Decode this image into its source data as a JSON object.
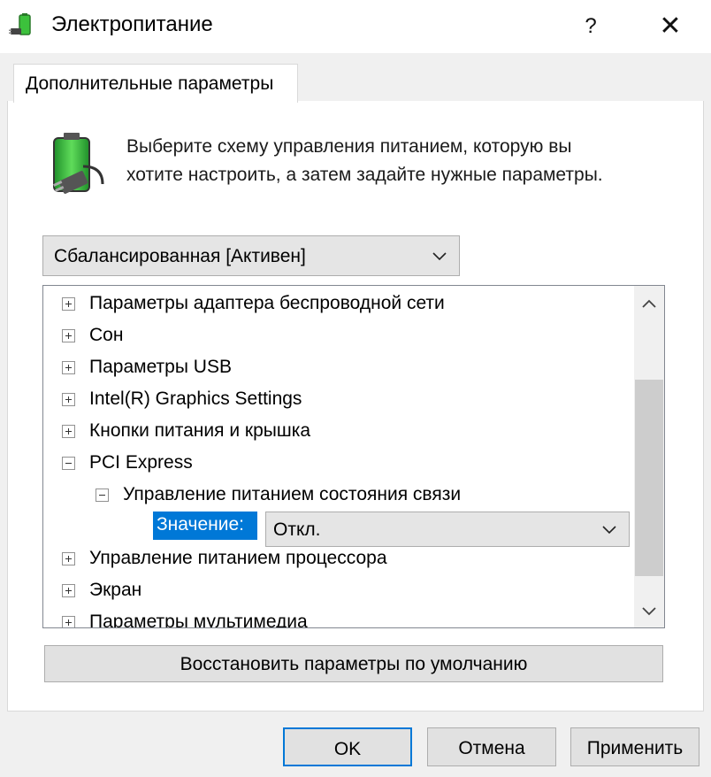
{
  "window": {
    "title": "Электропитание",
    "help": "?",
    "close": "✕"
  },
  "tab": {
    "label": "Дополнительные параметры"
  },
  "description": {
    "line1": "Выберите схему управления питанием, которую вы",
    "line2": "хотите настроить, а затем задайте нужные параметры."
  },
  "plan": {
    "selected": "Сбалансированная [Активен]"
  },
  "tree": {
    "items": [
      {
        "label": "Параметры адаптера беспроводной сети",
        "expanded": false
      },
      {
        "label": "Сон",
        "expanded": false
      },
      {
        "label": "Параметры USB",
        "expanded": false
      },
      {
        "label": "Intel(R) Graphics Settings",
        "expanded": false
      },
      {
        "label": "Кнопки питания и крышка",
        "expanded": false
      },
      {
        "label": "PCI Express",
        "expanded": true
      },
      {
        "label": "Управление питанием состояния связи",
        "expanded": true
      },
      {
        "label": "Управление питанием процессора",
        "expanded": false
      },
      {
        "label": "Экран",
        "expanded": false
      },
      {
        "label": "Параметры мультимедиа",
        "expanded": false
      }
    ],
    "value_label": "Значение:",
    "value_selected": "Откл."
  },
  "buttons": {
    "restore": "Восстановить параметры по умолчанию",
    "ok": "OK",
    "cancel": "Отмена",
    "apply": "Применить"
  },
  "colors": {
    "accent": "#0078d7",
    "battery": "#3cc13c"
  }
}
